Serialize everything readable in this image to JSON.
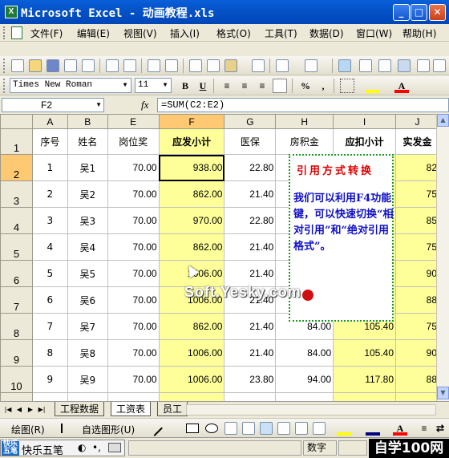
{
  "window": {
    "title": "Microsoft Excel - 动画教程.xls"
  },
  "menu": [
    "文件(F)",
    "编辑(E)",
    "视图(V)",
    "插入(I)",
    "格式(O)",
    "工具(T)",
    "数据(D)",
    "窗口(W)",
    "帮助(H)"
  ],
  "format_toolbar": {
    "font": "Times New Roman",
    "size": "11",
    "bold": "B",
    "underline": "U",
    "percent": "%",
    "comma": ","
  },
  "formula_bar": {
    "cell_ref": "F2",
    "fx": "fx",
    "formula": "=SUM(C2:E2)"
  },
  "grid": {
    "column_letters": [
      "A",
      "B",
      "E",
      "F",
      "G",
      "H",
      "I",
      "J"
    ],
    "row_numbers": [
      "1",
      "2",
      "3",
      "4",
      "5",
      "6",
      "7",
      "8",
      "9",
      "10"
    ],
    "header": [
      "序号",
      "姓名",
      "岗位奖",
      "应发小计",
      "医保",
      "房积金",
      "应扣小计",
      "实发金"
    ],
    "rows": [
      [
        "1",
        "吴1",
        "70.00",
        "938.00",
        "22.80",
        "",
        "",
        "82"
      ],
      [
        "2",
        "吴2",
        "70.00",
        "862.00",
        "21.40",
        "",
        "",
        "75"
      ],
      [
        "3",
        "吴3",
        "70.00",
        "970.00",
        "22.80",
        "",
        "",
        "85"
      ],
      [
        "4",
        "吴4",
        "70.00",
        "862.00",
        "21.40",
        "",
        "",
        "75"
      ],
      [
        "5",
        "吴5",
        "70.00",
        "1006.00",
        "21.40",
        "",
        "",
        "90"
      ],
      [
        "6",
        "吴6",
        "70.00",
        "1006.00",
        "21.40",
        "",
        "",
        "88"
      ],
      [
        "7",
        "吴7",
        "70.00",
        "862.00",
        "21.40",
        "84.00",
        "105.40",
        "75"
      ],
      [
        "8",
        "吴8",
        "70.00",
        "1006.00",
        "21.40",
        "84.00",
        "105.40",
        "90"
      ],
      [
        "9",
        "吴9",
        "70.00",
        "1006.00",
        "23.80",
        "94.00",
        "117.80",
        "88"
      ]
    ]
  },
  "note": {
    "title": "引用方式转换",
    "body": "我们可以利用F4功能键，可以快速切换“相对引用”和“绝对引用格式”。"
  },
  "watermark": "Soft.Yesky.com",
  "sheet_tabs": [
    "工程数据",
    "工资表",
    "员工"
  ],
  "draw_toolbar": {
    "draw": "绘图(R)",
    "autoshapes": "自选图形(U)"
  },
  "status": {
    "ime": "快乐五笔",
    "ime_logo": "快乐五笔",
    "mode": "数字",
    "brand": "自学100网"
  },
  "colors": {
    "title_bar": "#0553C8",
    "selected_header": "#FFC873",
    "highlight_fill": "#FFFF99",
    "note_title": "#E00000",
    "note_body": "#1010C8",
    "note_border": "#1a9a1a"
  }
}
